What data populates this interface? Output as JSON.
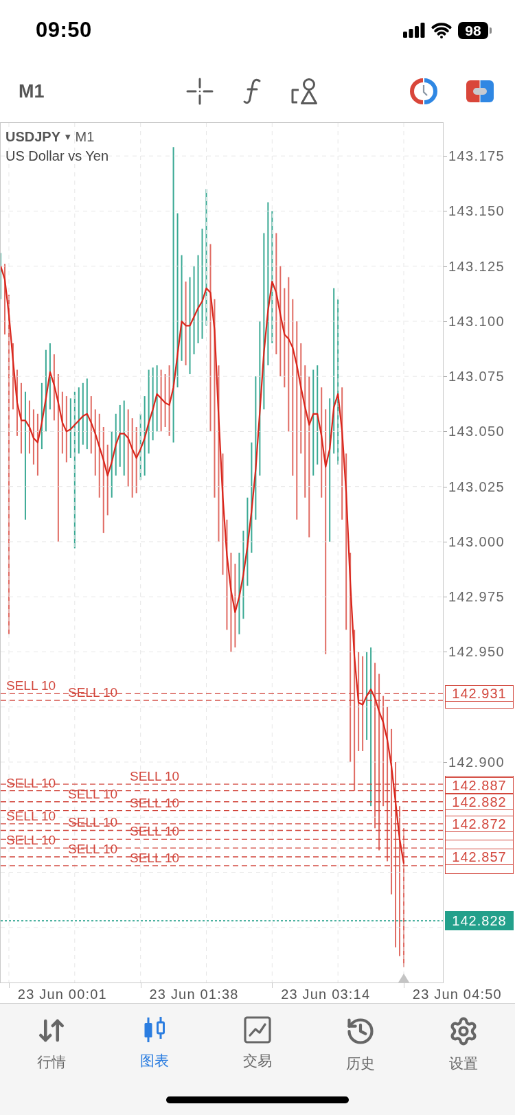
{
  "status_bar": {
    "time": "09:50",
    "battery": "98"
  },
  "toolbar": {
    "timeframe": "M1"
  },
  "chart": {
    "symbol": "USDJPY",
    "caret": "▾",
    "timeframe": "M1",
    "description": "US Dollar vs Yen",
    "chart_data": {
      "type": "line",
      "grid": true,
      "ylim": [
        142.8,
        143.19
      ],
      "categories": [
        null,
        null,
        null,
        null,
        null,
        null,
        null,
        null,
        null,
        null,
        null,
        null,
        null,
        null,
        null,
        "23 Jun 00:01",
        null,
        null,
        null,
        null,
        null,
        null,
        null,
        null,
        null,
        null,
        null,
        null,
        null,
        null,
        null,
        null,
        null,
        null,
        null,
        null,
        null,
        null,
        null,
        null,
        null,
        null,
        null,
        null,
        null,
        null,
        null,
        "23 Jun 01:38",
        null,
        null,
        null,
        null,
        null,
        null,
        null,
        null,
        null,
        null,
        null,
        null,
        null,
        null,
        null,
        null,
        null,
        null,
        null,
        null,
        null,
        null,
        null,
        null,
        null,
        null,
        null,
        null,
        null,
        null,
        null,
        "23 Jun 03:14",
        null,
        null,
        null,
        null,
        null,
        null,
        null,
        null,
        null,
        null,
        null,
        null,
        null,
        null,
        null,
        null,
        null,
        null,
        null,
        null,
        null,
        null,
        null,
        null,
        null,
        null,
        null,
        null,
        null,
        null,
        null,
        "23 Jun 04:50"
      ],
      "yticks": [
        {
          "value": 143.175,
          "label": "143.175"
        },
        {
          "value": 143.15,
          "label": "143.150"
        },
        {
          "value": 143.125,
          "label": "143.125"
        },
        {
          "value": 143.1,
          "label": "143.100"
        },
        {
          "value": 143.075,
          "label": "143.075"
        },
        {
          "value": 143.05,
          "label": "143.050"
        },
        {
          "value": 143.025,
          "label": "143.025"
        },
        {
          "value": 143.0,
          "label": "143.000"
        },
        {
          "value": 142.975,
          "label": "142.975"
        },
        {
          "value": 142.95,
          "label": "142.950"
        },
        {
          "value": 142.9,
          "label": "142.900"
        }
      ],
      "series": [
        {
          "color": "#d9261c",
          "values": [
            143.125,
            143.119,
            143.103,
            143.082,
            143.063,
            143.055,
            143.055,
            143.052,
            143.047,
            143.045,
            143.054,
            143.065,
            143.077,
            143.071,
            143.063,
            143.054,
            143.05,
            143.051,
            143.053,
            143.055,
            143.057,
            143.058,
            143.054,
            143.049,
            143.043,
            143.037,
            143.03,
            143.036,
            143.044,
            143.049,
            143.049,
            143.047,
            143.042,
            143.038,
            143.042,
            143.047,
            143.054,
            143.06,
            143.067,
            143.065,
            143.063,
            143.062,
            143.07,
            143.085,
            143.1,
            143.098,
            143.098,
            143.102,
            143.106,
            143.109,
            143.115,
            143.113,
            143.096,
            143.056,
            143.02,
            142.994,
            142.978,
            142.968,
            142.975,
            142.985,
            142.998,
            143.014,
            143.033,
            143.059,
            143.086,
            143.105,
            143.118,
            143.113,
            143.103,
            143.094,
            143.092,
            143.088,
            143.08,
            143.07,
            143.061,
            143.053,
            143.058,
            143.058,
            143.048,
            143.034,
            143.042,
            143.061,
            143.067,
            143.05,
            143.022,
            142.981,
            142.948,
            142.927,
            142.926,
            142.93,
            142.933,
            142.929,
            142.923,
            142.918,
            142.91,
            142.898,
            142.882,
            142.865,
            142.854,
            null,
            null,
            null,
            null,
            null,
            null,
            null,
            null,
            null,
            null,
            null,
            null,
            null
          ]
        }
      ],
      "ref_lines": [
        {
          "axis": "y",
          "value": 142.931,
          "label": "SELL 10",
          "color": "#d2463c"
        },
        {
          "axis": "y",
          "value": 142.928,
          "label": "SELL 10",
          "color": "#d2463c"
        },
        {
          "axis": "y",
          "value": 142.89,
          "label": "SELL 10",
          "color": "#d2463c"
        },
        {
          "axis": "y",
          "value": 142.887,
          "label": "SELL 10",
          "color": "#d2463c"
        },
        {
          "axis": "y",
          "value": 142.882,
          "label": "SELL 10",
          "color": "#d2463c"
        },
        {
          "axis": "y",
          "value": 142.878,
          "label": "SELL 10",
          "color": "#d2463c"
        },
        {
          "axis": "y",
          "value": 142.872,
          "label": "SELL 10",
          "color": "#d2463c"
        },
        {
          "axis": "y",
          "value": 142.869,
          "label": "SELL 10",
          "color": "#d2463c"
        },
        {
          "axis": "y",
          "value": 142.865,
          "label": "SELL 10",
          "color": "#d2463c"
        },
        {
          "axis": "y",
          "value": 142.861,
          "label": "SELL 10",
          "color": "#d2463c"
        },
        {
          "axis": "y",
          "value": 142.857,
          "label": "SELL 10",
          "color": "#d2463c"
        },
        {
          "axis": "y",
          "value": 142.853,
          "label": "SELL 10",
          "color": "#d2463c"
        },
        {
          "axis": "y",
          "value": 142.828,
          "color": "#23a08b"
        }
      ],
      "annotations": [
        "142.931",
        "142.887",
        "142.882",
        "142.872",
        "142.857",
        "142.828"
      ]
    }
  },
  "tabs": [
    {
      "label": "行情",
      "selected": false
    },
    {
      "label": "图表",
      "selected": true
    },
    {
      "label": "交易",
      "selected": false
    },
    {
      "label": "历史",
      "selected": false
    },
    {
      "label": "设置",
      "selected": false
    }
  ]
}
